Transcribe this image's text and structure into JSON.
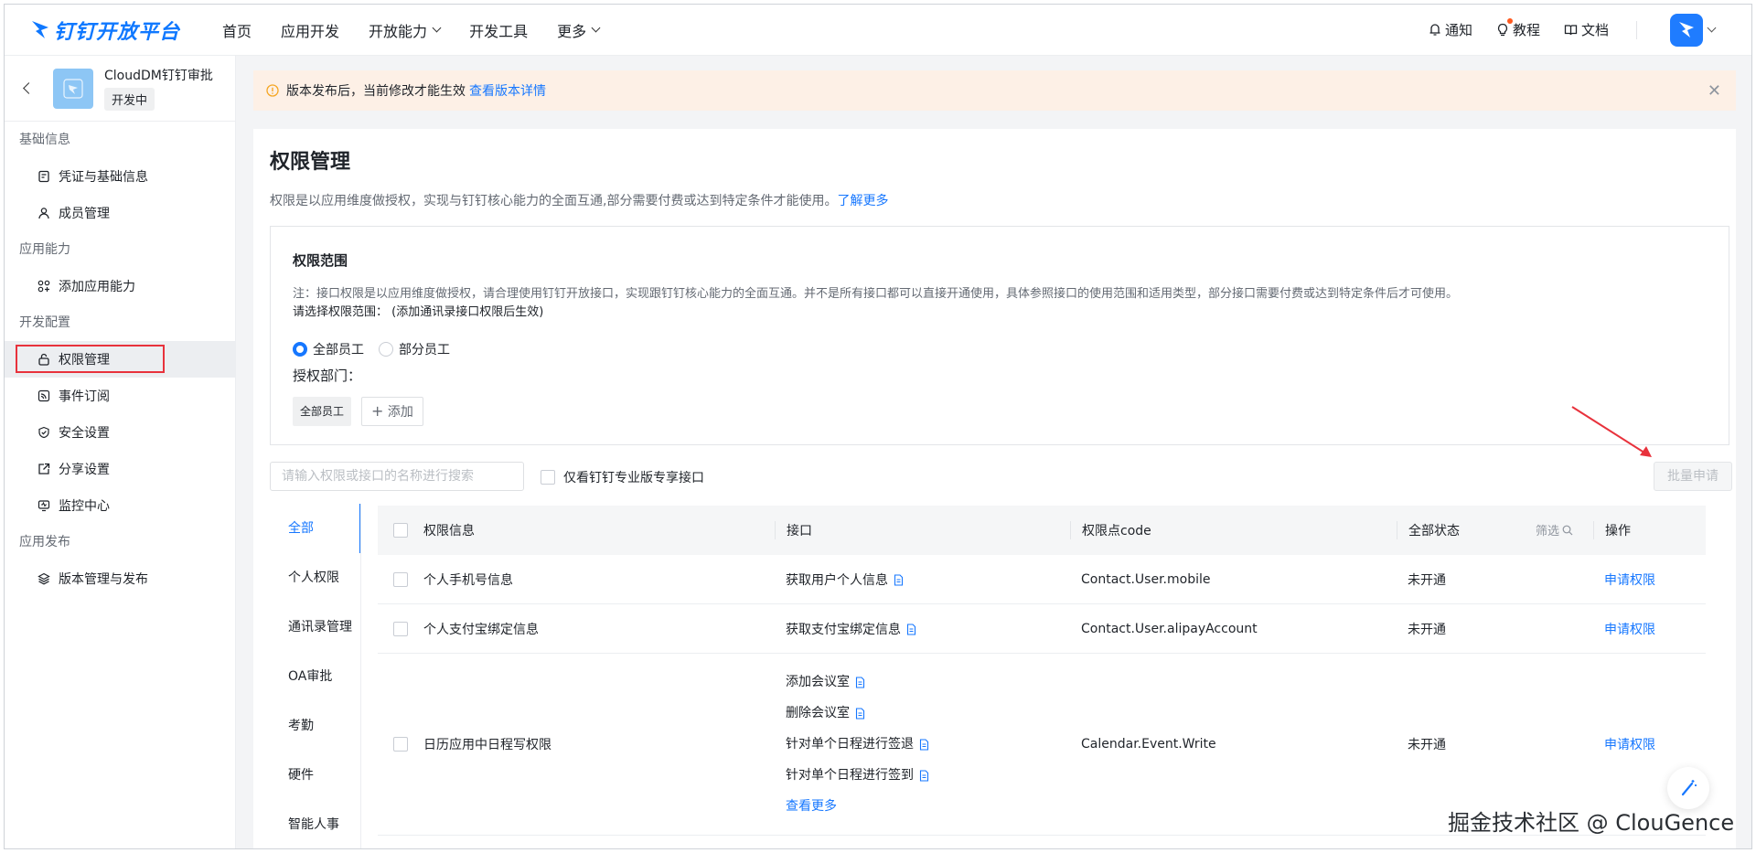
{
  "brand": {
    "name": "钉钉开放平台"
  },
  "nav": [
    {
      "label": "首页",
      "dropdown": false
    },
    {
      "label": "应用开发",
      "dropdown": false
    },
    {
      "label": "开放能力",
      "dropdown": true
    },
    {
      "label": "开发工具",
      "dropdown": false
    },
    {
      "label": "更多",
      "dropdown": true
    }
  ],
  "top_right": {
    "notify": "通知",
    "tutorial": "教程",
    "docs": "文档"
  },
  "app": {
    "name": "CloudDM钉钉审批",
    "status": "开发中"
  },
  "sidebar": {
    "groups": [
      {
        "title": "基础信息",
        "items": [
          {
            "label": "凭证与基础信息",
            "icon": "credential-icon"
          },
          {
            "label": "成员管理",
            "icon": "user-icon"
          }
        ]
      },
      {
        "title": "应用能力",
        "items": [
          {
            "label": "添加应用能力",
            "icon": "grid-add-icon"
          }
        ]
      },
      {
        "title": "开发配置",
        "items": [
          {
            "label": "权限管理",
            "icon": "lock-icon",
            "active": true
          },
          {
            "label": "事件订阅",
            "icon": "rss-icon"
          },
          {
            "label": "安全设置",
            "icon": "shield-icon"
          },
          {
            "label": "分享设置",
            "icon": "share-icon"
          },
          {
            "label": "监控中心",
            "icon": "monitor-icon"
          }
        ]
      },
      {
        "title": "应用发布",
        "items": [
          {
            "label": "版本管理与发布",
            "icon": "layers-icon"
          }
        ]
      }
    ]
  },
  "banner": {
    "text": "版本发布后，当前修改才能生效",
    "link": "查看版本详情"
  },
  "page": {
    "title": "权限管理",
    "desc": "权限是以应用维度做授权，实现与钉钉核心能力的全面互通,部分需要付费或达到特定条件才能使用。",
    "desc_link": "了解更多"
  },
  "scope": {
    "title": "权限范围",
    "note": "注：接口权限是以应用维度做授权，请合理使用钉钉开放接口，实现跟钉钉核心能力的全面互通。并不是所有接口都可以直接开通使用，具体参照接口的使用范围和适用类型，部分接口需要付费或达到特定条件后才可使用。",
    "select_label": "请选择权限范围：  (添加通讯录接口权限后生效)",
    "radio_all": "全部员工",
    "radio_part": "部分员工",
    "auth_dept_label": "授权部门：",
    "dept_tag": "全部员工",
    "add_label": "添加"
  },
  "toolbar": {
    "search_placeholder": "请输入权限或接口的名称进行搜索",
    "only_pro": "仅看钉钉专业版专享接口",
    "batch_apply": "批量申请"
  },
  "categories": [
    "全部",
    "个人权限",
    "通讯录管理",
    "OA审批",
    "考勤",
    "硬件",
    "智能人事"
  ],
  "table": {
    "headers": {
      "info": "权限信息",
      "api": "接口",
      "code": "权限点code",
      "status": "全部状态",
      "filter": "筛选",
      "action": "操作"
    },
    "rows": [
      {
        "info": "个人手机号信息",
        "apis": [
          "获取用户个人信息"
        ],
        "code": "Contact.User.mobile",
        "status": "未开通",
        "action": "申请权限"
      },
      {
        "info": "个人支付宝绑定信息",
        "apis": [
          "获取支付宝绑定信息"
        ],
        "code": "Contact.User.alipayAccount",
        "status": "未开通",
        "action": "申请权限"
      },
      {
        "info": "日历应用中日程写权限",
        "apis": [
          "添加会议室",
          "删除会议室",
          "针对单个日程进行签退",
          "针对单个日程进行签到"
        ],
        "more": "查看更多",
        "code": "Calendar.Event.Write",
        "status": "未开通",
        "action": "申请权限"
      }
    ]
  },
  "watermark": "掘金技术社区 @ ClouGence",
  "colors": {
    "accent": "#1677ff",
    "brand": "#0f78ff",
    "annotation": "#e8323c",
    "banner_bg": "#fdf0e6"
  }
}
